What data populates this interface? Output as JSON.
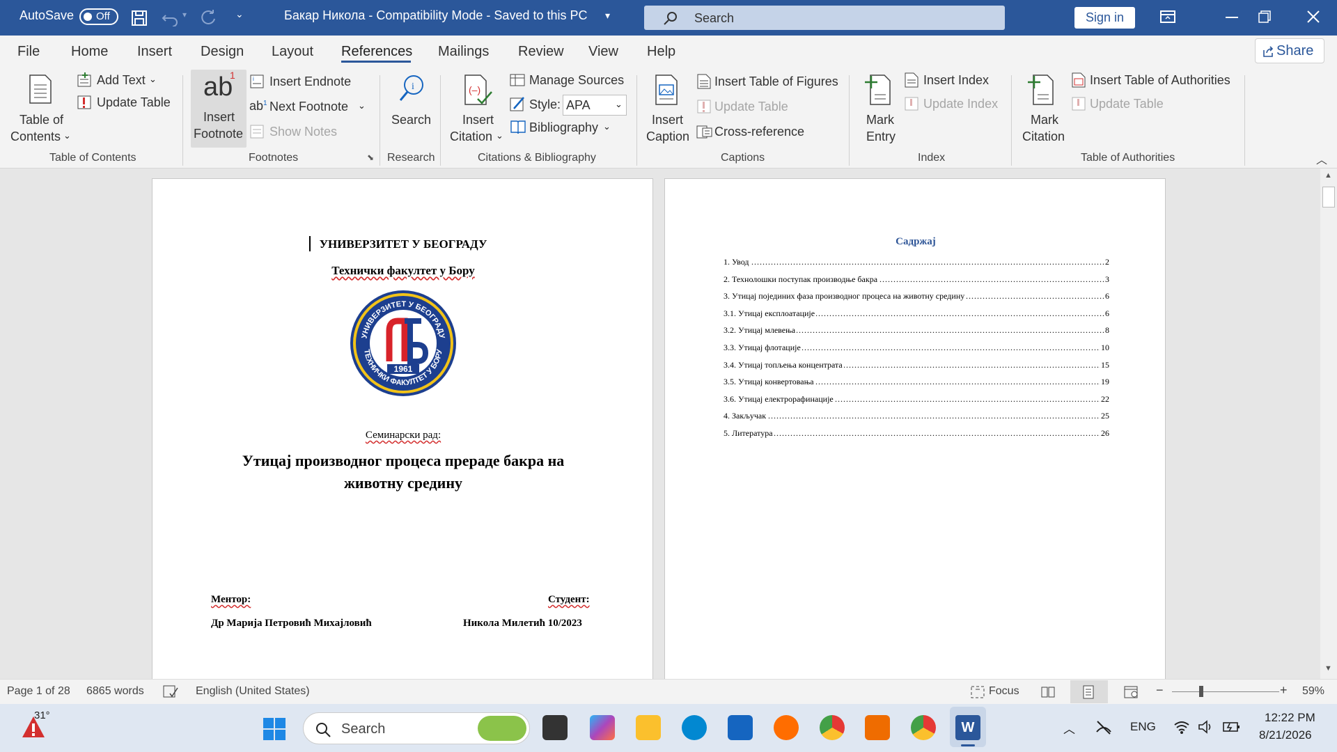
{
  "titlebar": {
    "autosave_label": "AutoSave",
    "autosave_state": "Off",
    "doc_title": "Бакар Никола  -  Compatibility Mode  -  Saved to this PC",
    "search_placeholder": "Search",
    "signin_label": "Sign in"
  },
  "tabs": [
    "File",
    "Home",
    "Insert",
    "Design",
    "Layout",
    "References",
    "Mailings",
    "Review",
    "View",
    "Help"
  ],
  "active_tab": "References",
  "share_label": "Share",
  "ribbon": {
    "toc": {
      "table_of_contents": "Table of",
      "table_of_contents2": "Contents",
      "add_text": "Add Text",
      "update_table": "Update Table",
      "group": "Table of Contents"
    },
    "footnotes": {
      "insert_footnote": "Insert",
      "insert_footnote2": "Footnote",
      "insert_endnote": "Insert Endnote",
      "next_footnote": "Next Footnote",
      "show_notes": "Show Notes",
      "group": "Footnotes"
    },
    "research": {
      "search": "Search",
      "group": "Research"
    },
    "citations": {
      "insert_citation": "Insert",
      "insert_citation2": "Citation",
      "manage_sources": "Manage Sources",
      "style_label": "Style:",
      "style_value": "APA",
      "bibliography": "Bibliography",
      "group": "Citations & Bibliography"
    },
    "captions": {
      "insert_caption": "Insert",
      "insert_caption2": "Caption",
      "insert_table_of_figures": "Insert Table of Figures",
      "update_table": "Update Table",
      "cross_reference": "Cross-reference",
      "group": "Captions"
    },
    "index": {
      "mark_entry": "Mark",
      "mark_entry2": "Entry",
      "insert_index": "Insert Index",
      "update_index": "Update Index",
      "group": "Index"
    },
    "authorities": {
      "mark_citation": "Mark",
      "mark_citation2": "Citation",
      "insert_toa": "Insert Table of Authorities",
      "update_table": "Update Table",
      "group": "Table of Authorities"
    }
  },
  "page1": {
    "university": "УНИВЕРЗИТЕТ У БЕОГРАДУ",
    "faculty": "Технички факултет у Бору",
    "logo_ring_top": "УНИВЕРЗИТЕТ У БЕОГРАДУ",
    "logo_ring_bottom": "ТЕХНИЧКИ ФАКУЛТЕТ У БОРУ",
    "logo_year": "1961",
    "paper_type": "Семинарски рад:",
    "title_line1": "Утицај производног процеса прераде бакра на",
    "title_line2": "животну средину",
    "mentor_label": "Ментор:",
    "student_label": "Студент:",
    "mentor_name": "Др Марија Петровић Михајловић",
    "student_name": "Никола Милетић 10/2023"
  },
  "page2": {
    "toc_heading": "Садржај",
    "toc_entries": [
      {
        "title": "1.  Увод",
        "page": "2"
      },
      {
        "title": "2. Технолошки поступак производње бакра",
        "page": "3"
      },
      {
        "title": "3. Утицај појединих фаза производног процеса на животну средину",
        "page": "6"
      },
      {
        "title": "3.1. Утицај експлоатације",
        "page": "6"
      },
      {
        "title": "3.2. Утицај млевења",
        "page": "8"
      },
      {
        "title": "3.3. Утицај флотације",
        "page": "10"
      },
      {
        "title": "3.4. Утицај топљења концентрата",
        "page": "15"
      },
      {
        "title": "3.5. Утицај конвертовања",
        "page": "19"
      },
      {
        "title": "3.6. Утицај електрорафинације",
        "page": "22"
      },
      {
        "title": "4. Закључак",
        "page": "25"
      },
      {
        "title": "5. Литература",
        "page": "26"
      }
    ]
  },
  "status": {
    "page": "Page 1 of 28",
    "words": "6865 words",
    "language": "English (United States)",
    "focus": "Focus",
    "zoom": "59%"
  },
  "taskbar": {
    "weather_temp": "31°",
    "search_label": "Search",
    "lang": "ENG",
    "time": "12:22 PM",
    "date": "8/21/2026"
  },
  "colors": {
    "word_blue": "#2b579a",
    "toc_heading": "#2e5597",
    "logo_red": "#d8232a",
    "logo_blue": "#1d3f8f",
    "logo_gold": "#f2c318"
  }
}
